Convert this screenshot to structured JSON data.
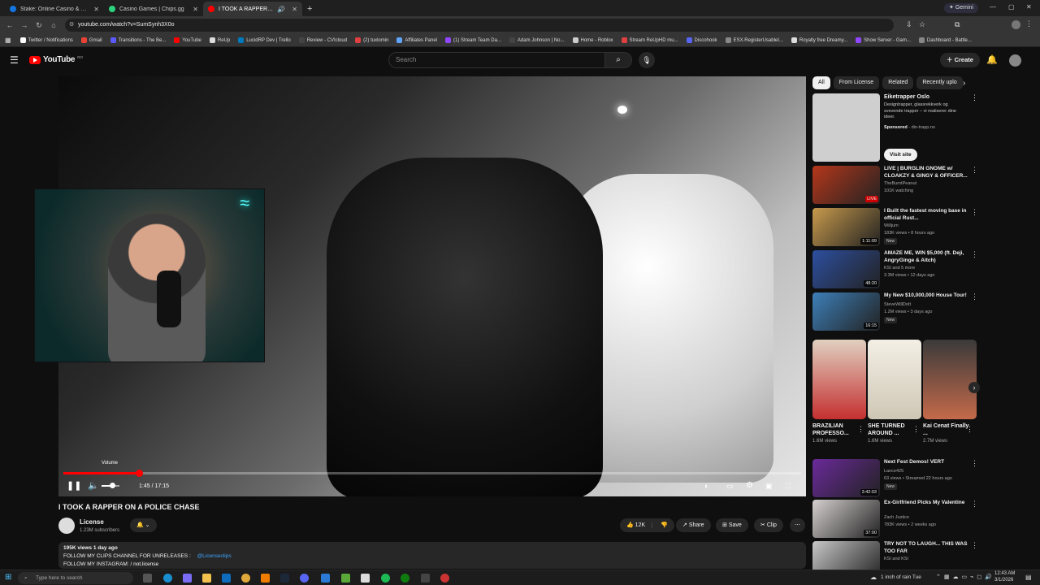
{
  "browser": {
    "tabs": [
      {
        "title": "Stake: Online Casino & Sports B",
        "color": "#1475e1",
        "active": false
      },
      {
        "title": "Casino Games | Chips.gg",
        "color": "#2bd47d",
        "active": false
      },
      {
        "title": "I TOOK A RAPPER ON A PO",
        "color": "#ff0000",
        "active": true
      }
    ],
    "new_tab_label": "+",
    "gemini_label": "Gemini",
    "url": "youtube.com/watch?v=SumSynh3X0o",
    "bookmarks": [
      {
        "label": "Twitter / Notifications",
        "color": "#ffffff"
      },
      {
        "label": "Gmail",
        "color": "#ea4335"
      },
      {
        "label": "Transitions - The Be...",
        "color": "#5a5aff"
      },
      {
        "label": "YouTube",
        "color": "#ff0000"
      },
      {
        "label": "ReUp",
        "color": "#dddddd"
      },
      {
        "label": "LucidRP Dev | Trello",
        "color": "#0079bf"
      },
      {
        "label": "Review - CVIcloud",
        "color": "#444444"
      },
      {
        "label": "(2) tuxlomin",
        "color": "#e04040"
      },
      {
        "label": "Affiliates Panel",
        "color": "#60a5fa"
      },
      {
        "label": "(1) Stream Team Da...",
        "color": "#9146ff"
      },
      {
        "label": "Adam Johnson | No...",
        "color": "#444444"
      },
      {
        "label": "Home - Roblox",
        "color": "#cccccc"
      },
      {
        "label": "Stream ReUpHD mu...",
        "color": "#e04040"
      },
      {
        "label": "Discohook",
        "color": "#5865f2"
      },
      {
        "label": "ESX.RegisterUsableI...",
        "color": "#888888"
      },
      {
        "label": "Royalty free Dreamy...",
        "color": "#dddddd"
      },
      {
        "label": "Show Server - Gam...",
        "color": "#9146ff"
      },
      {
        "label": "Dashboard - Battle...",
        "color": "#888888"
      }
    ]
  },
  "youtube": {
    "logo_text": "YouTube",
    "region": "RO",
    "search_placeholder": "Search",
    "create_label": "Create"
  },
  "player": {
    "volume_tooltip": "Volume",
    "time": "1:45 / 17:15",
    "progress": 0.102,
    "volume": 0.6
  },
  "video": {
    "title": "I TOOK A RAPPER ON A POLICE CHASE",
    "channel": "License",
    "subscribers": "1.23M subscribers",
    "likes": "12K",
    "share_label": "Share",
    "save_label": "Save",
    "clip_label": "Clip",
    "views_date": "195K views  1 day ago",
    "desc_line1": "FOLLOW MY CLIPS CHANNEL FOR UNRELEASES :",
    "desc_link1": "@Licenseclips",
    "desc_line2": "FOLLOW MY INSTAGRAM:",
    "desc_link2": "/ not.license"
  },
  "chips": [
    {
      "label": "All",
      "selected": true
    },
    {
      "label": "From License",
      "selected": false
    },
    {
      "label": "Related",
      "selected": false
    },
    {
      "label": "Recently uplo",
      "selected": false
    }
  ],
  "ad": {
    "title": "Eiketrapper Oslo",
    "text": "Designtrapper, glassrekkverk og svevende trapper – vi realiserer dine ideer.",
    "sponsored": "Sponsored",
    "domain": "din-trapp.no",
    "cta": "Visit site"
  },
  "recs": [
    {
      "title": "LIVE | BURGLIN GNOME w/ CLOAKZY & GINGY & OFFICER...",
      "channel": "TheBurntPeanut",
      "meta": "101K watching",
      "badge": "LIVE",
      "new": "",
      "color": "#b5371b"
    },
    {
      "title": "I Built the fastest moving base in official Rust...",
      "channel": "Willjum",
      "meta": "183K views • 8 hours ago",
      "badge": "1:11:09",
      "new": "New",
      "color": "#c79a4c"
    },
    {
      "title": "AMAZE ME, WIN $5,000 (ft. Deji, AngryGinge & Aitch)",
      "channel": "KSI and 5 more",
      "meta": "3.3M views • 12 days ago",
      "badge": "48:20",
      "new": "",
      "color": "#2d4f9f"
    },
    {
      "title": "My New $10,000,000 House Tour!",
      "channel": "SteveWillDoIt",
      "meta": "1.2M views • 3 days ago",
      "badge": "16:15",
      "new": "New",
      "color": "#3d7fb8"
    }
  ],
  "shorts": [
    {
      "title": "BRAZILIAN PROFESSO...",
      "views": "1.6M views",
      "color": "#c43030"
    },
    {
      "title": "SHE TURNED AROUND ...",
      "views": "1.6M views",
      "color": "#e8e2d2"
    },
    {
      "title": "Kai Cenat Finally ...",
      "views": "2.7M views",
      "color": "#7a2a2a"
    }
  ],
  "recs2": [
    {
      "title": "Next Fest Demos! VERT",
      "channel": "Lance425",
      "meta": "63 views • Streamed 22 hours ago",
      "badge": "3:42:03",
      "new": "New",
      "color": "#6a2a9a"
    },
    {
      "title": "Ex-Girlfriend Picks My Valentine",
      "channel": "Zach Justice",
      "meta": "783K views • 2 weeks ago",
      "badge": "37:00",
      "new": "",
      "color": "#d6d0d0"
    },
    {
      "title": "TRY NOT TO LAUGH... THIS WAS TOO FAR",
      "channel": "KSI and KSI",
      "meta": "",
      "badge": "",
      "new": "",
      "color": "#c7c7c7"
    }
  ],
  "taskbar": {
    "search_placeholder": "Type here to search",
    "weather": "1 inch of rain Tue",
    "time": "12:43 AM",
    "date": "3/1/2026"
  }
}
